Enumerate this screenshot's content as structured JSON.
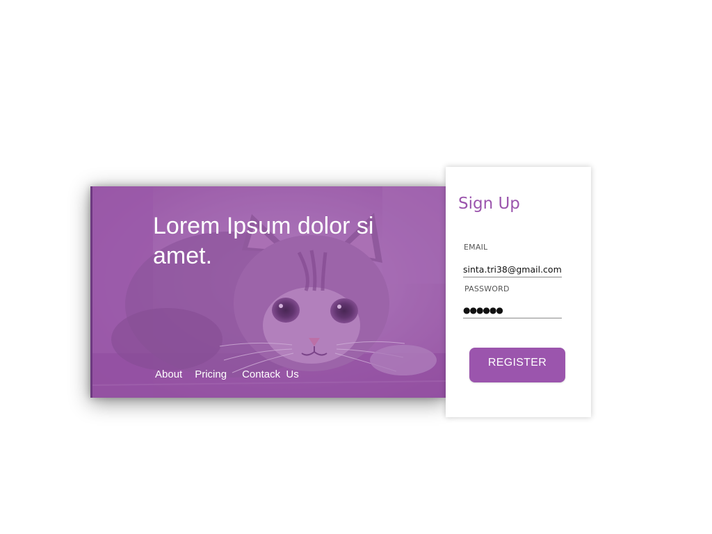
{
  "hero": {
    "title": "Lorem Ipsum dolor si amet.",
    "nav": [
      "About",
      "Pricing",
      "Contack  Us"
    ]
  },
  "signup": {
    "title": "Sign Up",
    "email_label": "EMAIL",
    "email_value": "sinta.tri38@gmail.com",
    "password_label": "PASSWORD",
    "password_dots": "●●●●●●",
    "register_label": "REGISTER"
  },
  "colors": {
    "accent": "#9b55ad",
    "overlay": "#9b55ad",
    "text_on_accent": "#ffffff",
    "label": "#555555"
  },
  "icons": {
    "hero_image": "cat-photo"
  }
}
